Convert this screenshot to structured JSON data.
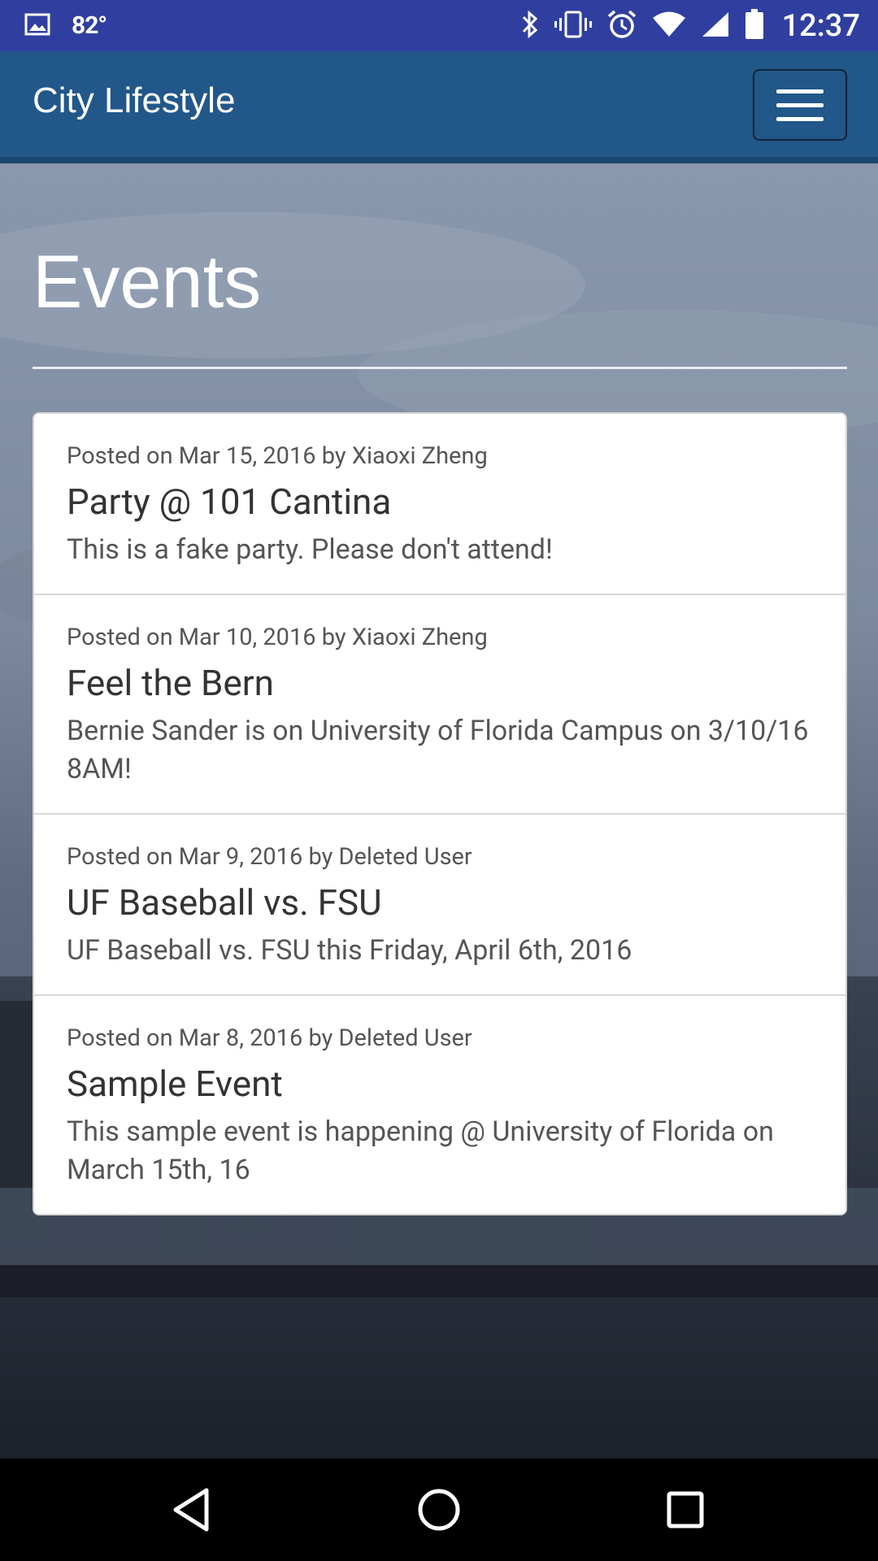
{
  "status_bar": {
    "temperature": "82°",
    "time": "12:37",
    "icons": [
      "image-icon",
      "bluetooth-icon",
      "vibrate-icon",
      "alarm-icon",
      "wifi-icon",
      "cell-signal-icon",
      "battery-icon"
    ]
  },
  "app_bar": {
    "brand": "City Lifestyle",
    "menu_icon": "hamburger-menu-icon"
  },
  "page": {
    "title": "Events"
  },
  "events": [
    {
      "meta": "Posted on Mar 15, 2016 by Xiaoxi Zheng",
      "title": "Party @ 101 Cantina",
      "description": "This is a fake party. Please don't attend!"
    },
    {
      "meta": "Posted on Mar 10, 2016 by Xiaoxi Zheng",
      "title": "Feel the Bern",
      "description": "Bernie Sander is on University of Florida Campus on 3/10/16 8AM!"
    },
    {
      "meta": "Posted on Mar 9, 2016 by Deleted User",
      "title": "UF Baseball vs. FSU",
      "description": "UF Baseball vs. FSU this Friday, April 6th, 2016"
    },
    {
      "meta": "Posted on Mar 8, 2016 by Deleted User",
      "title": "Sample Event",
      "description": "This sample event is happening @ University of Florida on March 15th, 16"
    }
  ],
  "nav_bar": {
    "icons": [
      "back-icon",
      "home-icon",
      "recents-icon"
    ]
  },
  "colors": {
    "status_bar": "#303f9f",
    "app_bar": "#22578a",
    "card_bg": "#ffffff"
  }
}
